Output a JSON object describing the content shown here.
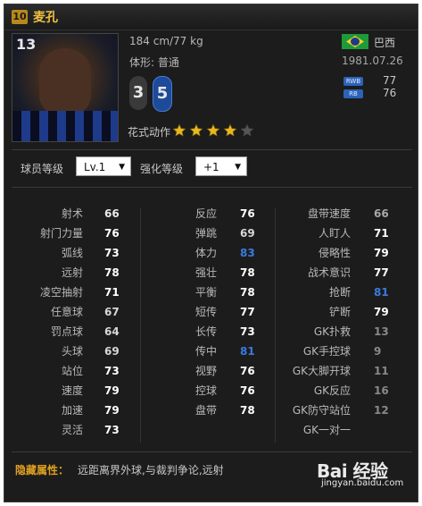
{
  "player": {
    "season_badge": "10",
    "name": "麦孔",
    "jersey_number": "13",
    "height_weight": "184 cm/77 kg",
    "body_type": "体形: 普通",
    "weak_foot": "3",
    "strong_foot": "5",
    "nationality": "巴西",
    "birth_date": "1981.07.26",
    "positions": [
      {
        "code": "RWB",
        "rating": "77"
      },
      {
        "code": "RB",
        "rating": "76"
      }
    ],
    "skill_moves_label": "花式动作",
    "skill_stars": 4,
    "skill_stars_max": 5
  },
  "controls": {
    "player_level_label": "球员等级",
    "player_level_value": "Lv.1",
    "enhance_level_label": "强化等级",
    "enhance_level_value": "+1"
  },
  "stats": {
    "columns": [
      [
        {
          "label": "射术",
          "value": "66",
          "color": "#e8e8e8"
        },
        {
          "label": "射门力量",
          "value": "76",
          "color": "#ffffff"
        },
        {
          "label": "弧线",
          "value": "73",
          "color": "#ffffff"
        },
        {
          "label": "远射",
          "value": "78",
          "color": "#ffffff"
        },
        {
          "label": "凌空抽射",
          "value": "71",
          "color": "#ffffff"
        },
        {
          "label": "任意球",
          "value": "67",
          "color": "#d8d8d8"
        },
        {
          "label": "罚点球",
          "value": "64",
          "color": "#d8d8d8"
        },
        {
          "label": "头球",
          "value": "69",
          "color": "#d8d8d8"
        },
        {
          "label": "站位",
          "value": "73",
          "color": "#ffffff"
        },
        {
          "label": "速度",
          "value": "79",
          "color": "#ffffff"
        },
        {
          "label": "加速",
          "value": "79",
          "color": "#ffffff"
        },
        {
          "label": "灵活",
          "value": "73",
          "color": "#ffffff"
        }
      ],
      [
        {
          "label": "反应",
          "value": "76",
          "color": "#ffffff"
        },
        {
          "label": "弹跳",
          "value": "69",
          "color": "#d8d8d8"
        },
        {
          "label": "体力",
          "value": "83",
          "color": "#3a7adf"
        },
        {
          "label": "强壮",
          "value": "78",
          "color": "#ffffff"
        },
        {
          "label": "平衡",
          "value": "78",
          "color": "#ffffff"
        },
        {
          "label": "短传",
          "value": "77",
          "color": "#ffffff"
        },
        {
          "label": "长传",
          "value": "73",
          "color": "#ffffff"
        },
        {
          "label": "传中",
          "value": "81",
          "color": "#3a7adf"
        },
        {
          "label": "视野",
          "value": "76",
          "color": "#ffffff"
        },
        {
          "label": "控球",
          "value": "76",
          "color": "#ffffff"
        },
        {
          "label": "盘带",
          "value": "78",
          "color": "#ffffff"
        }
      ],
      [
        {
          "label": "盘带速度",
          "value": "66",
          "color": "#a8a8a8"
        },
        {
          "label": "人盯人",
          "value": "71",
          "color": "#ffffff"
        },
        {
          "label": "侵略性",
          "value": "79",
          "color": "#ffffff"
        },
        {
          "label": "战术意识",
          "value": "77",
          "color": "#ffffff"
        },
        {
          "label": "抢断",
          "value": "81",
          "color": "#3a7adf"
        },
        {
          "label": "铲断",
          "value": "79",
          "color": "#ffffff"
        },
        {
          "label": "GK扑救",
          "value": "13",
          "color": "#888888"
        },
        {
          "label": "GK手控球",
          "value": "9",
          "color": "#888888"
        },
        {
          "label": "GK大脚开球",
          "value": "11",
          "color": "#888888"
        },
        {
          "label": "GK反应",
          "value": "16",
          "color": "#888888"
        },
        {
          "label": "GK防守站位",
          "value": "12",
          "color": "#888888"
        },
        {
          "label": "GK一对一",
          "value": "",
          "color": "#888888"
        }
      ]
    ]
  },
  "hidden_attributes": {
    "label": "隐藏属性：",
    "value": "远距离界外球,与裁判争论,远射"
  },
  "watermark": {
    "logo": "Bai 经验",
    "url": "jingyan.baidu.com"
  },
  "colors": {
    "accent_gold": "#f0c040",
    "highlight_blue": "#3a7adf",
    "hidden_label": "#e0a020"
  }
}
